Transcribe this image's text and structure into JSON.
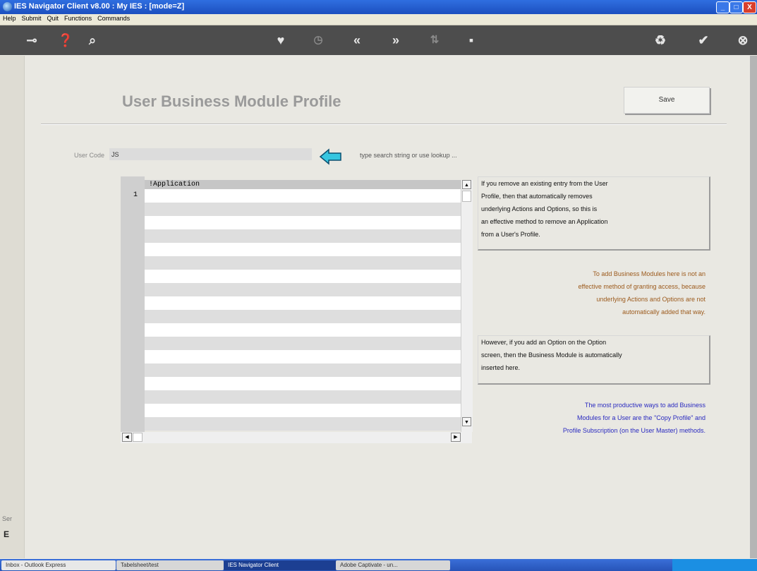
{
  "window": {
    "title": "IES Navigator Client v8.00 : My IES :       [mode=Z]"
  },
  "window_buttons": [
    "_",
    "□",
    "X"
  ],
  "menu": [
    "Help",
    "Submit",
    "Quit",
    "Functions",
    "Commands"
  ],
  "toolbar": {
    "icons": [
      "key-icon",
      "help-icon",
      "search-icon",
      "heart-icon",
      "clock-icon",
      "rewind-icon",
      "fast-forward-icon",
      "sort-icon",
      "grid-icon",
      "recycle-icon",
      "check-icon",
      "close-icon"
    ]
  },
  "page": {
    "title": "User Business Module Profile",
    "save_label": "Save",
    "user_code_label": "User Code",
    "user_code_value": "JS",
    "hint": "type search string or use lookup ..."
  },
  "grid": {
    "header": "!Application",
    "first_row_number": "1"
  },
  "notes": {
    "remove": [
      "If you remove an existing entry from the User",
      "Profile, then that automatically removes",
      "underlying Actions and Options, so this is",
      "an effective method to remove an Application",
      "from a User's Profile."
    ],
    "add": [
      "To add Business Modules here is not an",
      "effective method of granting access, because",
      "underlying Actions and Options are not",
      "automatically added that way."
    ],
    "option": [
      "However, if you add an Option on the Option",
      "screen, then the Business Module is automatically",
      "inserted here."
    ],
    "productive": [
      "The most productive ways to add Business",
      "Modules for a User are the \"Copy Profile\" and",
      "Profile Subscription (on the User Master) methods."
    ]
  },
  "colors": {
    "add_note": "#9c5a1c",
    "productive_note": "#2a2ac0"
  },
  "left_status": {
    "line1": "Ser",
    "line2": "E"
  },
  "taskbar": [
    "Inbox - Outlook Express",
    "Tabelsheet/test",
    "IES Navigator Client",
    "Adobe Captivate - un..."
  ]
}
